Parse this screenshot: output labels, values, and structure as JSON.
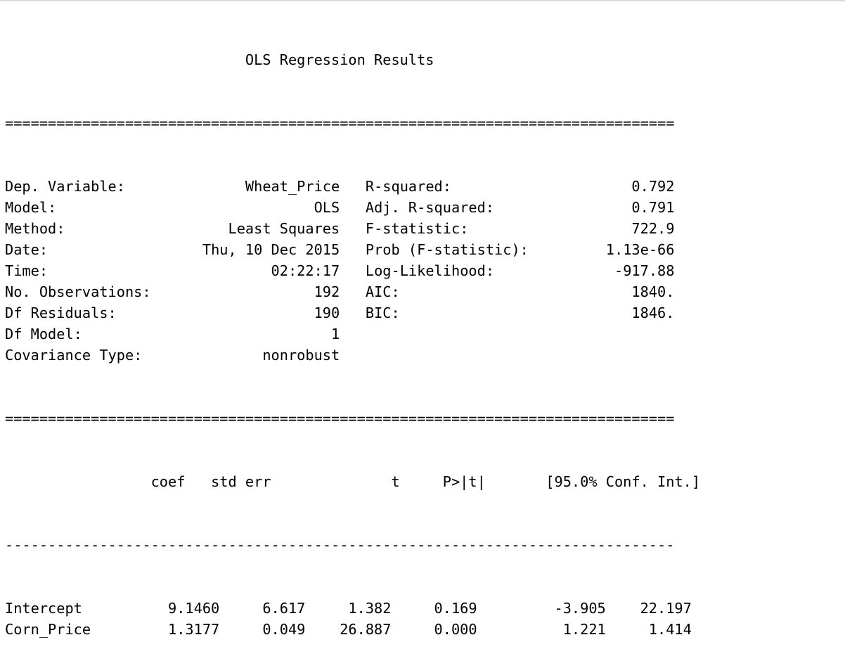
{
  "title": "OLS Regression Results",
  "separator_double": "==============================================================================",
  "separator_single": "------------------------------------------------------------------------------",
  "info_rows": [
    {
      "left_label": "Dep. Variable:",
      "left_value": "Wheat_Price",
      "right_label": "R-squared:",
      "right_value": "0.792"
    },
    {
      "left_label": "Model:",
      "left_value": "OLS",
      "right_label": "Adj. R-squared:",
      "right_value": "0.791"
    },
    {
      "left_label": "Method:",
      "left_value": "Least Squares",
      "right_label": "F-statistic:",
      "right_value": "722.9"
    },
    {
      "left_label": "Date:",
      "left_value": "Thu, 10 Dec 2015",
      "right_label": "Prob (F-statistic):",
      "right_value": "1.13e-66"
    },
    {
      "left_label": "Time:",
      "left_value": "02:22:17",
      "right_label": "Log-Likelihood:",
      "right_value": "-917.88"
    },
    {
      "left_label": "No. Observations:",
      "left_value": "192",
      "right_label": "AIC:",
      "right_value": "1840."
    },
    {
      "left_label": "Df Residuals:",
      "left_value": "190",
      "right_label": "BIC:",
      "right_value": "1846."
    },
    {
      "left_label": "Df Model:",
      "left_value": "1",
      "right_label": "",
      "right_value": ""
    },
    {
      "left_label": "Covariance Type:",
      "left_value": "nonrobust",
      "right_label": "",
      "right_value": ""
    }
  ],
  "coef_headers": [
    "coef",
    "std err",
    "t",
    "P>|t|",
    "[95.0% Conf. Int.]"
  ],
  "coef_rows": [
    {
      "name": "Intercept",
      "coef": "9.1460",
      "std_err": "6.617",
      "t": "1.382",
      "p": "0.169",
      "ci_low": "-3.905",
      "ci_high": "22.197"
    },
    {
      "name": "Corn_Price",
      "coef": "1.3177",
      "std_err": "0.049",
      "t": "26.887",
      "p": "0.000",
      "ci_low": "1.221",
      "ci_high": "1.414"
    }
  ]
}
